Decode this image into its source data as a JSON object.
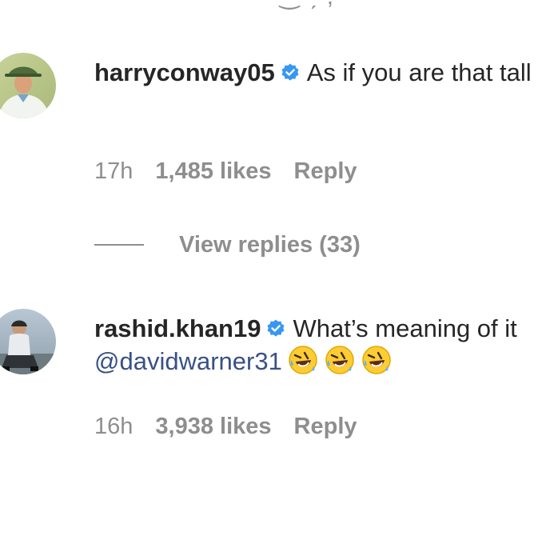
{
  "top_fragment": "(    )",
  "comments": [
    {
      "username": "harryconway05",
      "text": "As if you are that tall",
      "mention": "",
      "time": "17h",
      "likes": "1,485 likes",
      "reply_label": "Reply",
      "verified_icon": "verified-badge-icon",
      "avatar_icon": "user-avatar-cricketer-hat"
    },
    {
      "username": "rashid.khan19",
      "text": "What’s meaning of it",
      "mention": "@davidwarner31",
      "emojis": [
        "🤣",
        "🤣",
        "🤣"
      ],
      "time": "16h",
      "likes": "3,938 likes",
      "reply_label": "Reply",
      "verified_icon": "verified-badge-icon",
      "avatar_icon": "user-avatar-seated"
    }
  ],
  "view_replies": {
    "label": "View replies (33)"
  },
  "colors": {
    "text": "#262626",
    "secondary": "#8e8e8e",
    "link": "#385185",
    "verified": "#3897f0"
  }
}
